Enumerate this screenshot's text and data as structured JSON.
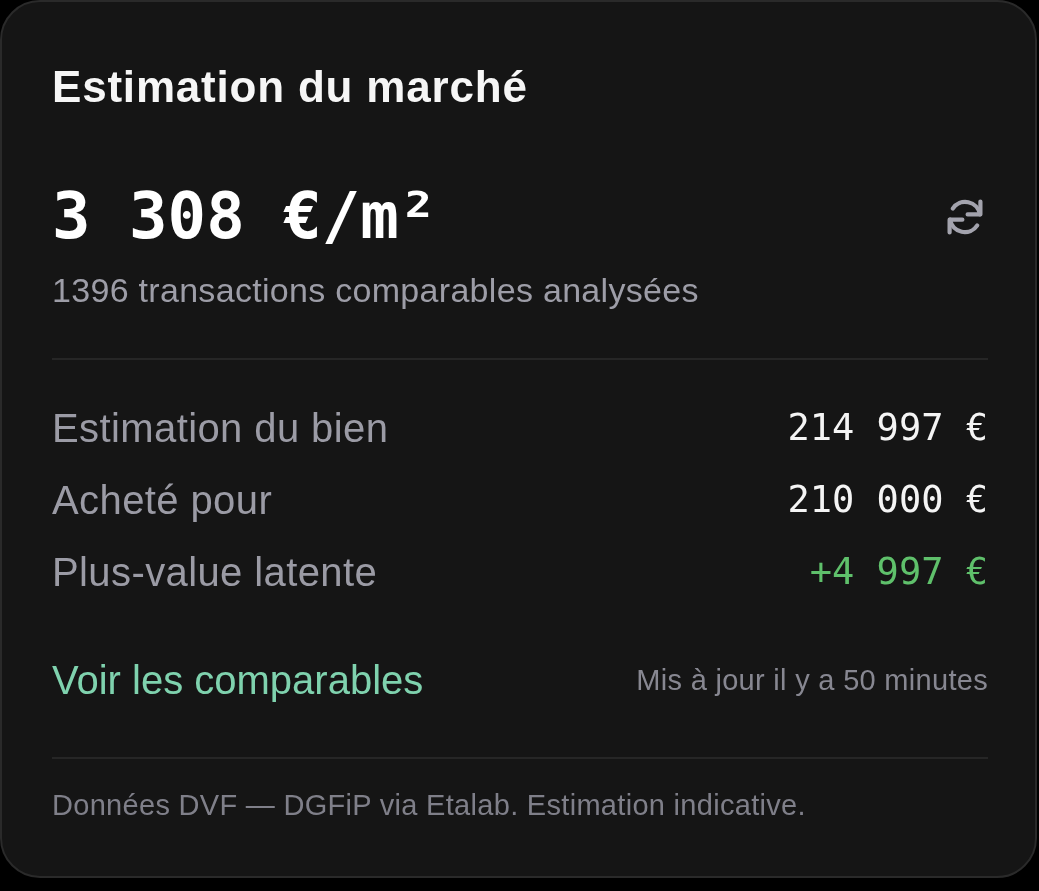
{
  "card": {
    "title": "Estimation du marché",
    "price": "3 308 €/m²",
    "subtitle": "1396 transactions comparables analysées",
    "rows": [
      {
        "label": "Estimation du bien",
        "value": "214 997 €",
        "kind": "plain"
      },
      {
        "label": "Acheté pour",
        "value": "210 000 €",
        "kind": "plain"
      },
      {
        "label": "Plus-value latente",
        "value": "+4 997 €",
        "kind": "gain"
      }
    ],
    "link": "Voir les comparables",
    "updated": "Mis à jour il y a 50 minutes",
    "footer": "Données DVF — DGFiP via Etalab. Estimation indicative."
  }
}
